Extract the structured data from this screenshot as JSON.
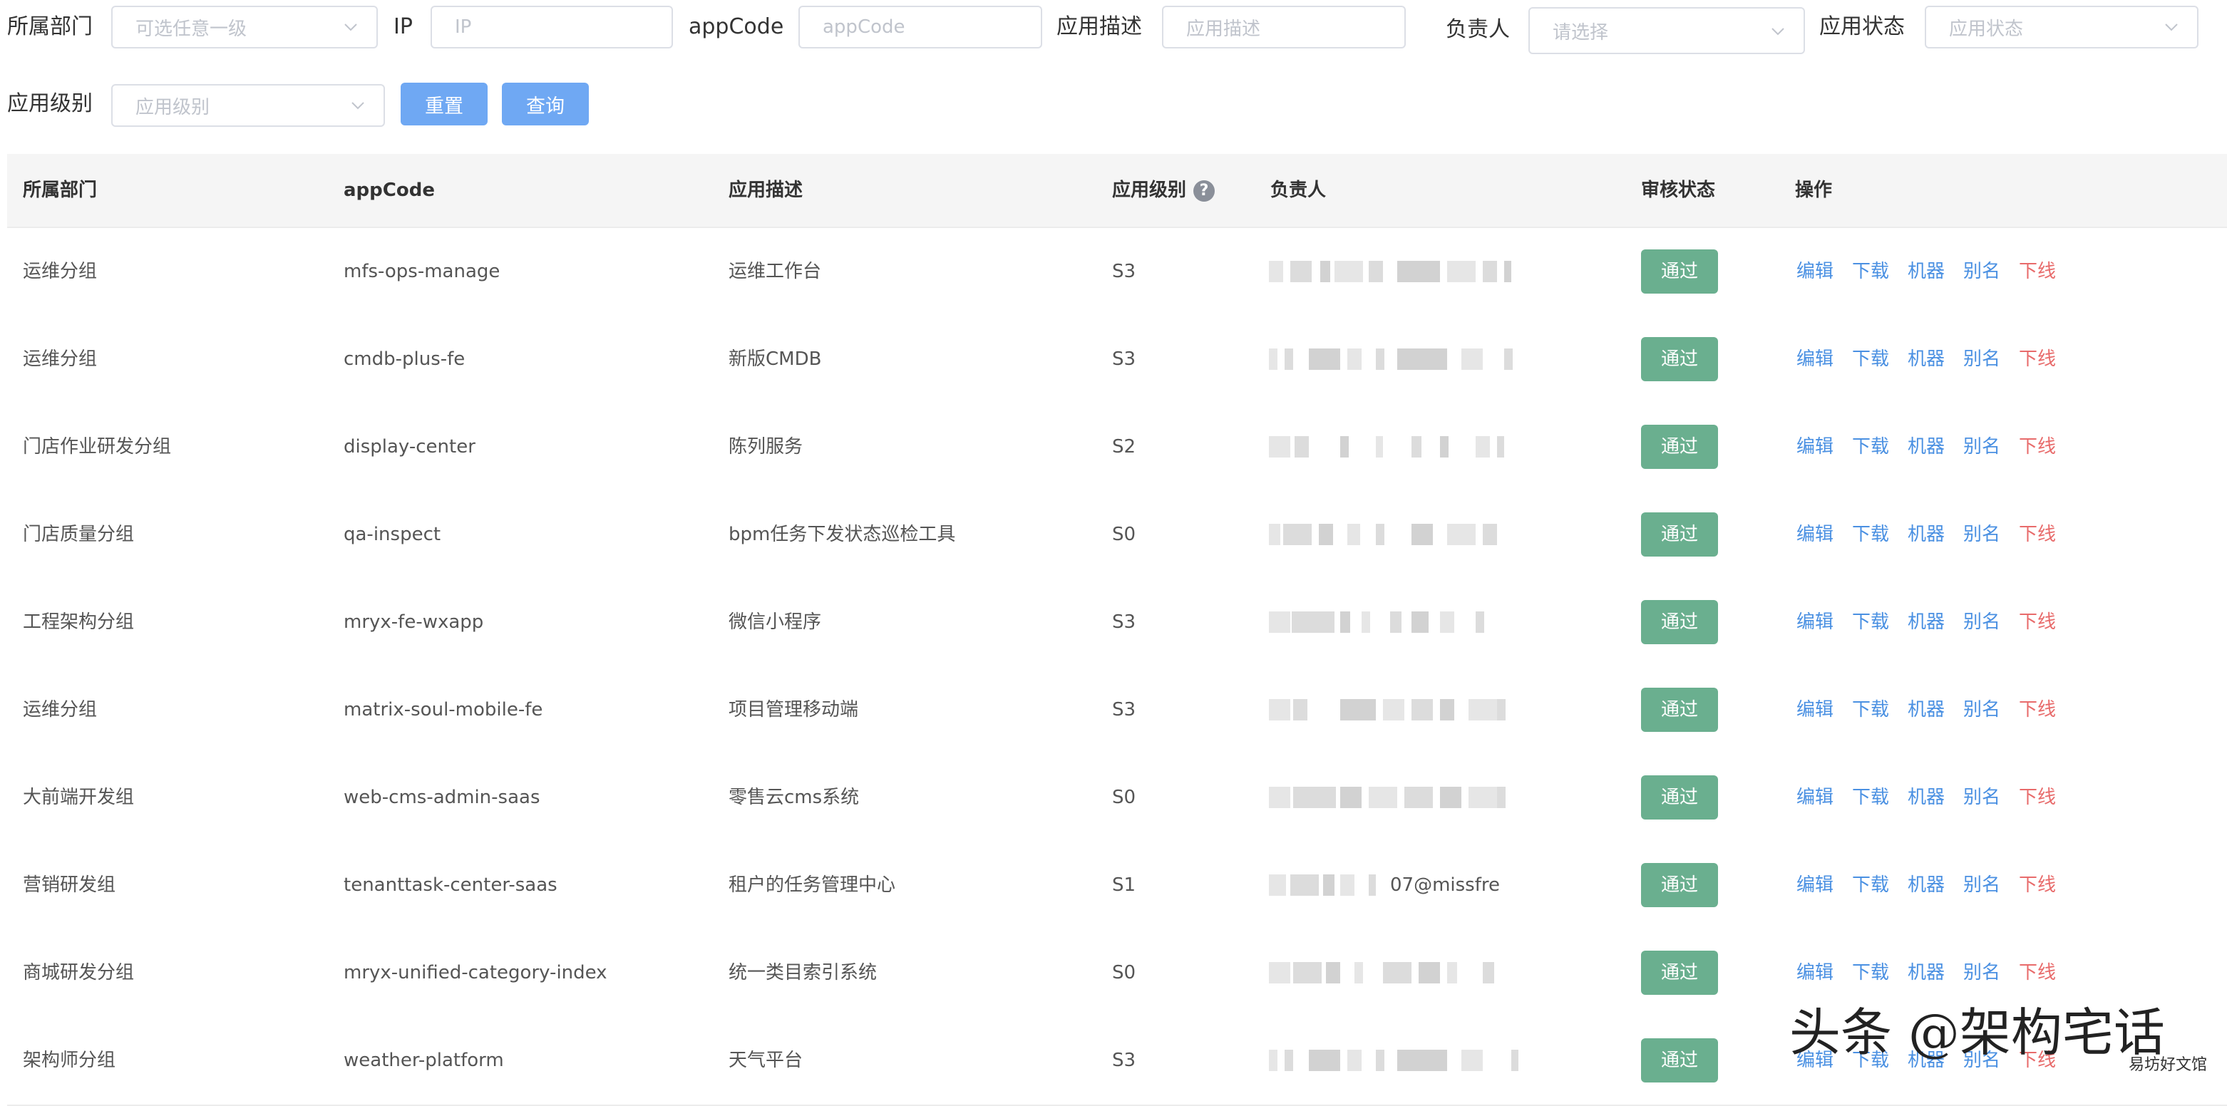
{
  "filters": {
    "dept": {
      "label": "所属部门",
      "placeholder": "可选任意一级"
    },
    "ip": {
      "label": "IP",
      "placeholder": "IP"
    },
    "appcode": {
      "label": "appCode",
      "placeholder": "appCode"
    },
    "desc": {
      "label": "应用描述",
      "placeholder": "应用描述"
    },
    "owner": {
      "label": "负责人",
      "placeholder": "请选择"
    },
    "status": {
      "label": "应用状态",
      "placeholder": "应用状态"
    },
    "level": {
      "label": "应用级别",
      "placeholder": "应用级别"
    }
  },
  "buttons": {
    "reset": "重置",
    "query": "查询"
  },
  "table": {
    "columns": {
      "dept": "所属部门",
      "appcode": "appCode",
      "desc": "应用描述",
      "level": "应用级别",
      "owner": "负责人",
      "review": "审核状态",
      "ops": "操作"
    },
    "help_icon": "?",
    "actions": {
      "edit": "编辑",
      "download": "下载",
      "machine": "机器",
      "alias": "别名",
      "offline": "下线"
    },
    "rows": [
      {
        "dept": "运维分组",
        "appcode": "mfs-ops-manage",
        "desc": "运维工作台",
        "level": "S3",
        "owner": "",
        "review": "通过"
      },
      {
        "dept": "运维分组",
        "appcode": "cmdb-plus-fe",
        "desc": "新版CMDB",
        "level": "S3",
        "owner": "",
        "review": "通过"
      },
      {
        "dept": "门店作业研发分组",
        "appcode": "display-center",
        "desc": "陈列服务",
        "level": "S2",
        "owner": "",
        "review": "通过"
      },
      {
        "dept": "门店质量分组",
        "appcode": "qa-inspect",
        "desc": "bpm任务下发状态巡检工具",
        "level": "S0",
        "owner": "",
        "review": "通过"
      },
      {
        "dept": "工程架构分组",
        "appcode": "mryx-fe-wxapp",
        "desc": "微信小程序",
        "level": "S3",
        "owner": "",
        "review": "通过"
      },
      {
        "dept": "运维分组",
        "appcode": "matrix-soul-mobile-fe",
        "desc": "项目管理移动端",
        "level": "S3",
        "owner": "",
        "review": "通过"
      },
      {
        "dept": "大前端开发组",
        "appcode": "web-cms-admin-saas",
        "desc": "零售云cms系统",
        "level": "S0",
        "owner": "",
        "review": "通过"
      },
      {
        "dept": "营销研发组",
        "appcode": "tenanttask-center-saas",
        "desc": "租户的任务管理中心",
        "level": "S1",
        "owner": "07@missfre",
        "review": "通过"
      },
      {
        "dept": "商城研发分组",
        "appcode": "mryx-unified-category-index",
        "desc": "统一类目索引系统",
        "level": "S0",
        "owner": "",
        "review": "通过"
      },
      {
        "dept": "架构师分组",
        "appcode": "weather-platform",
        "desc": "天气平台",
        "level": "S3",
        "owner": "",
        "review": "通过"
      }
    ]
  },
  "watermark": {
    "main": "头条 @架构宅话",
    "sub": "易坊好文馆"
  },
  "colors": {
    "primary_button": "#6fa8f3",
    "pass_badge": "#6aaf8f",
    "link": "#4a90e2",
    "danger_link": "#e86b6b"
  }
}
